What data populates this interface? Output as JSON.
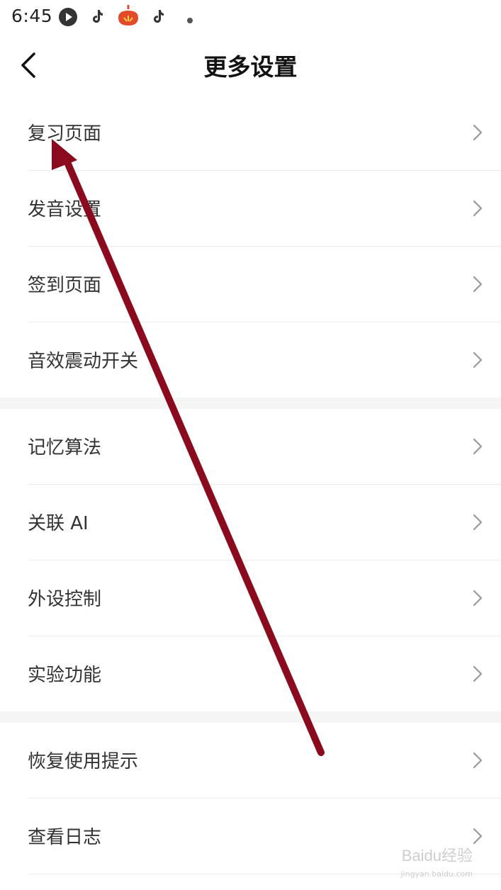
{
  "status_bar": {
    "time": "6:45",
    "icons": [
      "play-circle-icon",
      "tiktok-icon",
      "fruit-app-icon",
      "tiktok-icon",
      "dot-icon"
    ]
  },
  "header": {
    "title": "更多设置",
    "back_icon": "chevron-left-icon"
  },
  "sections": [
    {
      "items": [
        {
          "label": "复习页面"
        },
        {
          "label": "发音设置"
        },
        {
          "label": "签到页面"
        },
        {
          "label": "音效震动开关"
        }
      ]
    },
    {
      "items": [
        {
          "label": "记忆算法"
        },
        {
          "label": "关联 AI"
        },
        {
          "label": "外设控制"
        },
        {
          "label": "实验功能"
        }
      ]
    },
    {
      "items": [
        {
          "label": "恢复使用提示"
        },
        {
          "label": "查看日志"
        }
      ]
    }
  ],
  "annotation": {
    "color": "#8a0a1e"
  },
  "watermark": {
    "text": "Baidu经验",
    "subtext": "jingyan.baidu.com"
  }
}
